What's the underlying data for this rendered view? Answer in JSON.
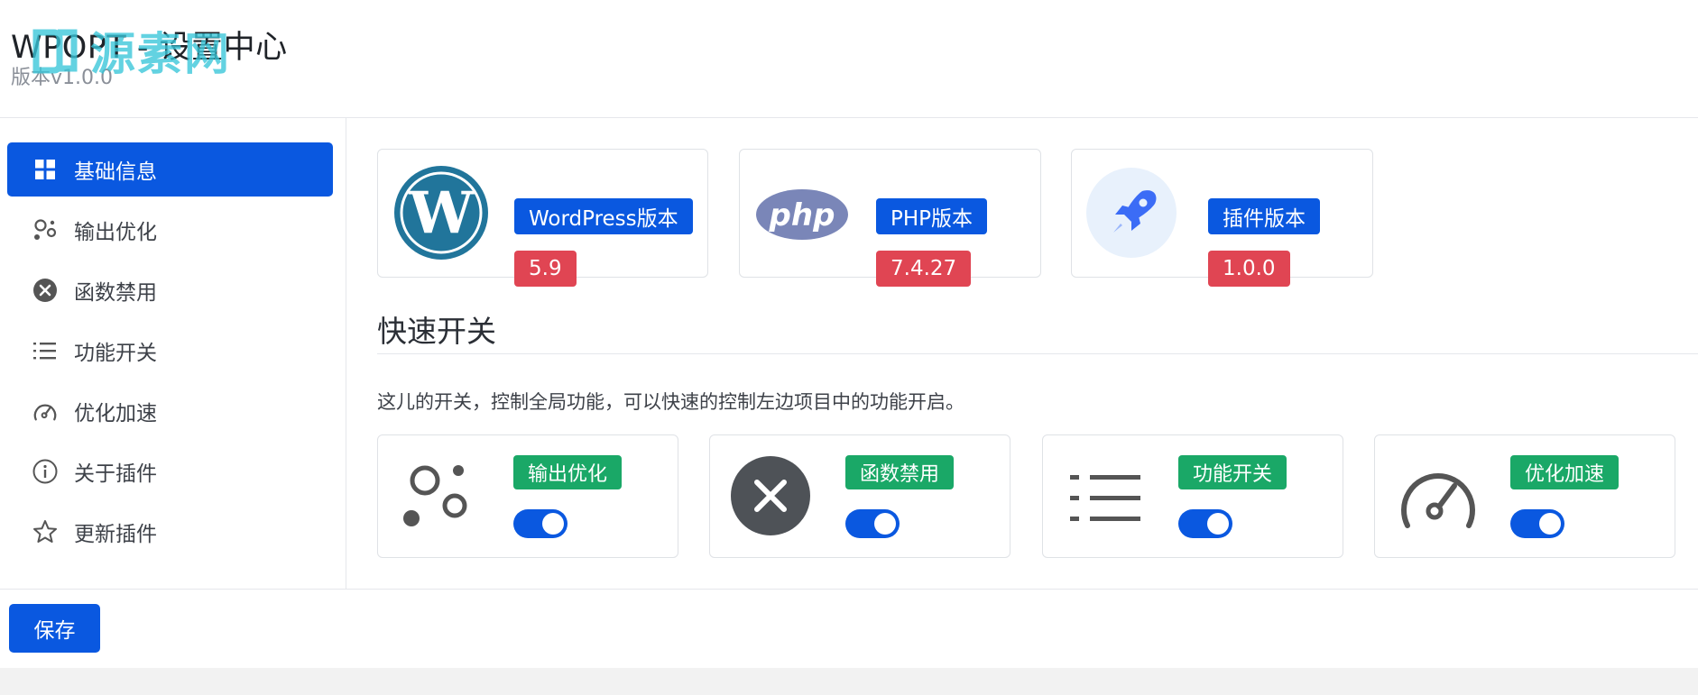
{
  "header": {
    "title": "WPOPT - 设置中心",
    "version": "版本v1.0.0",
    "watermark": "源素网"
  },
  "sidebar": {
    "items": [
      {
        "label": "基础信息",
        "icon": "grid-icon",
        "active": true
      },
      {
        "label": "输出优化",
        "icon": "bubbles-icon",
        "active": false
      },
      {
        "label": "函数禁用",
        "icon": "x-circle-icon",
        "active": false
      },
      {
        "label": "功能开关",
        "icon": "list-icon",
        "active": false
      },
      {
        "label": "优化加速",
        "icon": "speedometer-icon",
        "active": false
      },
      {
        "label": "关于插件",
        "icon": "info-circle-icon",
        "active": false
      },
      {
        "label": "更新插件",
        "icon": "star-icon",
        "active": false
      }
    ]
  },
  "versions": [
    {
      "label": "WordPress版本",
      "value": "5.9",
      "icon": "wordpress-logo-icon"
    },
    {
      "label": "PHP版本",
      "value": "7.4.27",
      "icon": "php-logo-icon"
    },
    {
      "label": "插件版本",
      "value": "1.0.0",
      "icon": "rocket-icon"
    }
  ],
  "quick_switch": {
    "title": "快速开关",
    "description": "这儿的开关，控制全局功能，可以快速的控制左边项目中的功能开启。",
    "items": [
      {
        "label": "输出优化",
        "icon": "bubbles-icon",
        "enabled": true
      },
      {
        "label": "函数禁用",
        "icon": "x-circle-icon",
        "enabled": true
      },
      {
        "label": "功能开关",
        "icon": "list-icon",
        "enabled": true
      },
      {
        "label": "优化加速",
        "icon": "speedometer-icon",
        "enabled": true
      }
    ]
  },
  "footer": {
    "save_label": "保存"
  },
  "colors": {
    "primary": "#0a58e0",
    "danger": "#e04553",
    "success": "#1aa867"
  }
}
